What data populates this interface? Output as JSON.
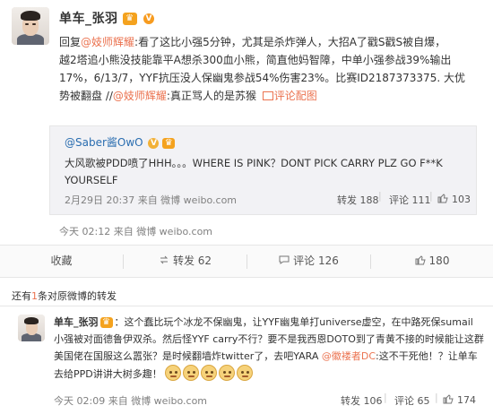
{
  "main_post": {
    "author": "单车_张羽",
    "badge": "V",
    "text_lines": [
      [
        "回复",
        "@妓师辉耀",
        ":看了这比小强5分钟，尤其是杀炸弹人，大招A了戳S戳S被自爆，"
      ],
      [
        "越2塔追小熊没技能靠平A想杀300血小熊，简直他妈智障，中单小强参战39%输出"
      ],
      [
        "17%，6/13/7，YYF抗压没人保幽鬼参战54%伤害23%。比赛ID2187373375. 大优"
      ],
      [
        "势被翻盘 //",
        "@妓师辉耀",
        ":真正骂人的是苏猴 ",
        "评论配图"
      ]
    ],
    "timestamp": "今天 02:12 来自 微博 weibo.com"
  },
  "repost": {
    "author": "@Saber酱OwO",
    "text_line1": "大风歌被PDD喷了HHH。。。WHERE IS PINK？DONT PICK CARRY PLZ GO F**K",
    "text_line2": "YOURSELF",
    "timestamp": "2月29日 20:37 来自 微博 weibo.com",
    "forward": "转发 188",
    "comment": "评论 111",
    "likes": "103"
  },
  "actions": {
    "favorite": "收藏",
    "forward": "转发 62",
    "comment": "评论 126",
    "likes": "180"
  },
  "notice": {
    "prefix": "还有",
    "count": "1",
    "suffix": "条对原微博的转发"
  },
  "second_post": {
    "author": "单车_张羽",
    "text_lines": [
      [
        "：这个蠢比玩个冰龙不保幽鬼，让YYF幽鬼单打universe虚空，在中路死保sumail"
      ],
      [
        "小强被对面德鲁伊双杀。然后怪YYF carry不行？要不是我西恩DOTO到了青黄不接的时候能让这群"
      ],
      [
        "美国佬在国服这么嚣张？是时候翻墙炸twitter了，去吧YARA ",
        "@徽褛者DC",
        ":这不干死他！？让单车"
      ],
      [
        "去给PPD讲讲大树多趣！"
      ]
    ],
    "timestamp": "今天 02:09 来自 微博 weibo.com",
    "forward": "转发 106",
    "comment": "评论 65",
    "likes": "174"
  },
  "colors": {
    "link": "#eb7350",
    "vip": "#f4a21e",
    "text": "#333333",
    "meta": "#808080"
  }
}
